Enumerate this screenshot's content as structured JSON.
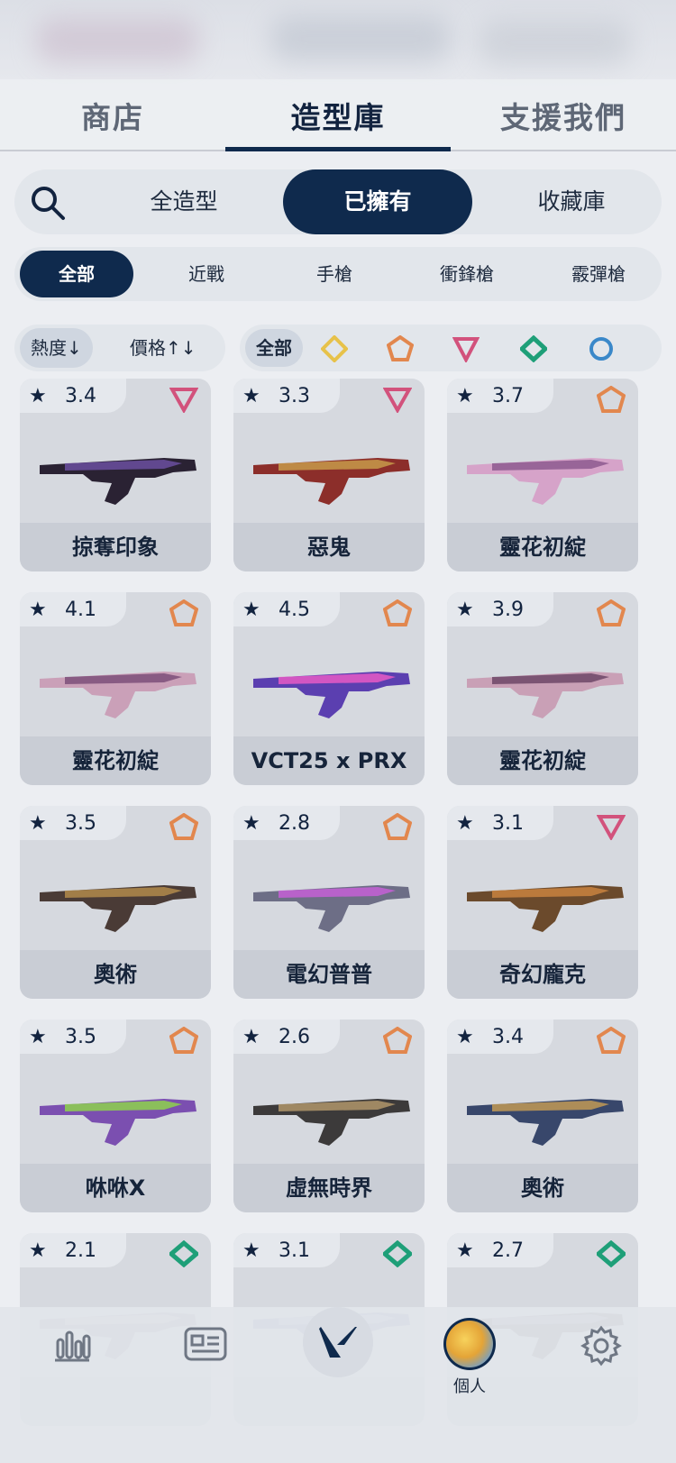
{
  "main_tabs": [
    {
      "label": "商店"
    },
    {
      "label": "造型庫"
    },
    {
      "label": "支援我們"
    }
  ],
  "ownership_tabs": [
    {
      "label": "全造型"
    },
    {
      "label": "已擁有"
    },
    {
      "label": "收藏庫"
    }
  ],
  "class_tabs": [
    {
      "label": "全部"
    },
    {
      "label": "近戰"
    },
    {
      "label": "手槍"
    },
    {
      "label": "衝鋒槍"
    },
    {
      "label": "霰彈槍"
    }
  ],
  "sort": {
    "popularity": "熱度↓",
    "price": "價格↑↓"
  },
  "tier_filter": {
    "all_label": "全部",
    "tiers": [
      "select-icon",
      "deluxe-icon",
      "premium-icon",
      "exclusive-icon",
      "ultra-icon"
    ],
    "colors": {
      "select": "#e7c24a",
      "deluxe": "#e2874e",
      "premium": "#d2527c",
      "exclusive": "#1e9f78",
      "ultra": "#3a88c9"
    }
  },
  "cards": [
    {
      "rating": "3.4",
      "tier": "premium",
      "name": "掠奪印象"
    },
    {
      "rating": "3.3",
      "tier": "premium",
      "name": "惡鬼"
    },
    {
      "rating": "3.7",
      "tier": "deluxe",
      "name": "靈花初綻"
    },
    {
      "rating": "4.1",
      "tier": "deluxe",
      "name": "靈花初綻"
    },
    {
      "rating": "4.5",
      "tier": "deluxe",
      "name": "VCT25 x PRX"
    },
    {
      "rating": "3.9",
      "tier": "deluxe",
      "name": "靈花初綻"
    },
    {
      "rating": "3.5",
      "tier": "deluxe",
      "name": "奧術"
    },
    {
      "rating": "2.8",
      "tier": "deluxe",
      "name": "電幻普普"
    },
    {
      "rating": "3.1",
      "tier": "premium",
      "name": "奇幻龐克"
    },
    {
      "rating": "3.5",
      "tier": "deluxe",
      "name": "咻咻X"
    },
    {
      "rating": "2.6",
      "tier": "deluxe",
      "name": "虛無時界"
    },
    {
      "rating": "3.4",
      "tier": "deluxe",
      "name": "奧術"
    },
    {
      "rating": "2.1",
      "tier": "exclusive",
      "name": ""
    },
    {
      "rating": "3.1",
      "tier": "exclusive",
      "name": ""
    },
    {
      "rating": "2.7",
      "tier": "exclusive",
      "name": ""
    }
  ],
  "bottom_nav": {
    "items": [
      "stats-icon",
      "news-icon",
      "valorant-logo",
      "profile-avatar",
      "gear-icon"
    ],
    "profile_label": "個人"
  }
}
